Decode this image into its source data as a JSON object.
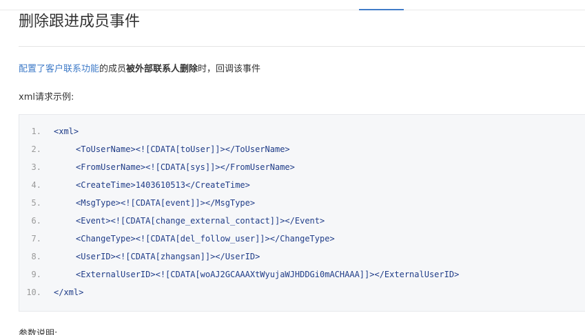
{
  "page": {
    "title": "删除跟进成员事件",
    "desc_link": "配置了客户联系功能",
    "desc_text1": "的成员",
    "desc_bold": "被外部联系人删除",
    "desc_text2": "时，回调该事件",
    "example_label": "xml请求示例:",
    "footer_label": "参数说明:"
  },
  "code": {
    "lines": [
      {
        "num": "1.",
        "text": "<xml>"
      },
      {
        "num": "2.",
        "text": "<ToUserName><![CDATA[toUser]]></ToUserName>"
      },
      {
        "num": "3.",
        "text": "<FromUserName><![CDATA[sys]]></FromUserName>"
      },
      {
        "num": "4.",
        "text": "<CreateTime>1403610513</CreateTime>"
      },
      {
        "num": "5.",
        "text": "<MsgType><![CDATA[event]]></MsgType>"
      },
      {
        "num": "6.",
        "text": "<Event><![CDATA[change_external_contact]]></Event>"
      },
      {
        "num": "7.",
        "text": "<ChangeType><![CDATA[del_follow_user]]></ChangeType>"
      },
      {
        "num": "8.",
        "text": "<UserID><![CDATA[zhangsan]]></UserID>"
      },
      {
        "num": "9.",
        "text": "<ExternalUserID><![CDATA[woAJ2GCAAAXtWyujaWJHDDGi0mACHAAA]]></ExternalUserID>"
      },
      {
        "num": "10.",
        "text": "</xml>"
      }
    ]
  },
  "colors": {
    "link": "#3f7bc8",
    "code_text": "#1f3c88",
    "code_bg": "#f6f7f9"
  }
}
